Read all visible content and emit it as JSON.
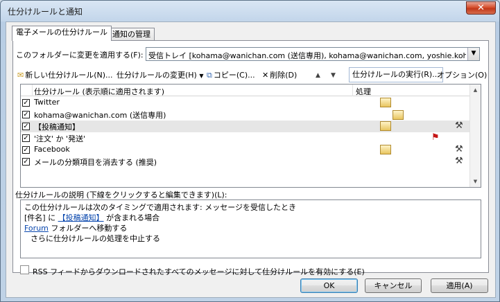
{
  "window": {
    "title": "仕分けルールと通知",
    "close_glyph": "✕"
  },
  "tabs": [
    {
      "label": "電子メールの仕分けルール"
    },
    {
      "label": "通知の管理"
    }
  ],
  "folder": {
    "label": "このフォルダーに変更を適用する(F):",
    "value": "受信トレイ [kohama@wanichan.com (送信専用), kohama@wanichan.com, yoshie.kohama@wani"
  },
  "toolbar": {
    "new_rule": "新しい仕分けルール(N)...",
    "change_rule": "仕分けルールの変更(H)",
    "copy": "コピー(C)...",
    "delete": "削除(D)",
    "run_rules": "仕分けルールの実行(R)...",
    "options": "オプション(O)"
  },
  "rules_list": {
    "col_rule": "仕分けルール (表示順に適用されます)",
    "col_action": "処理",
    "rows": [
      {
        "name": "Twitter",
        "checked": true
      },
      {
        "name": "kohama@wanichan.com (送信専用)",
        "checked": true
      },
      {
        "name": "【投稿通知】",
        "checked": true
      },
      {
        "name": "'注文' か '発送'",
        "checked": true
      },
      {
        "name": "Facebook",
        "checked": true
      },
      {
        "name": "メールの分類項目を消去する (推奨)",
        "checked": true
      }
    ]
  },
  "description": {
    "label": "仕分けルールの説明 (下線をクリックすると編集できます)(L):",
    "line1": "この仕分けルールは次のタイミングで適用されます: メッセージを受信したとき",
    "line2_pre": "[件名] に ",
    "line2_link": "【投稿通知】",
    "line2_post": " が含まれる場合",
    "line3_link": "Forum",
    "line3_post": " フォルダーへ移動する",
    "line4": "さらに仕分けルールの処理を中止する"
  },
  "rss": {
    "label": "RSS フィードからダウンロードされたすべてのメッセージに対して仕分けルールを有効にする(E)",
    "checked": false
  },
  "buttons": {
    "ok": "OK",
    "cancel": "キャンセル",
    "apply": "適用(A)"
  },
  "colors": {
    "titlebar": "#c2d5ea",
    "close": "#c1381a",
    "link": "#0645ad",
    "flag": "#c51616"
  }
}
